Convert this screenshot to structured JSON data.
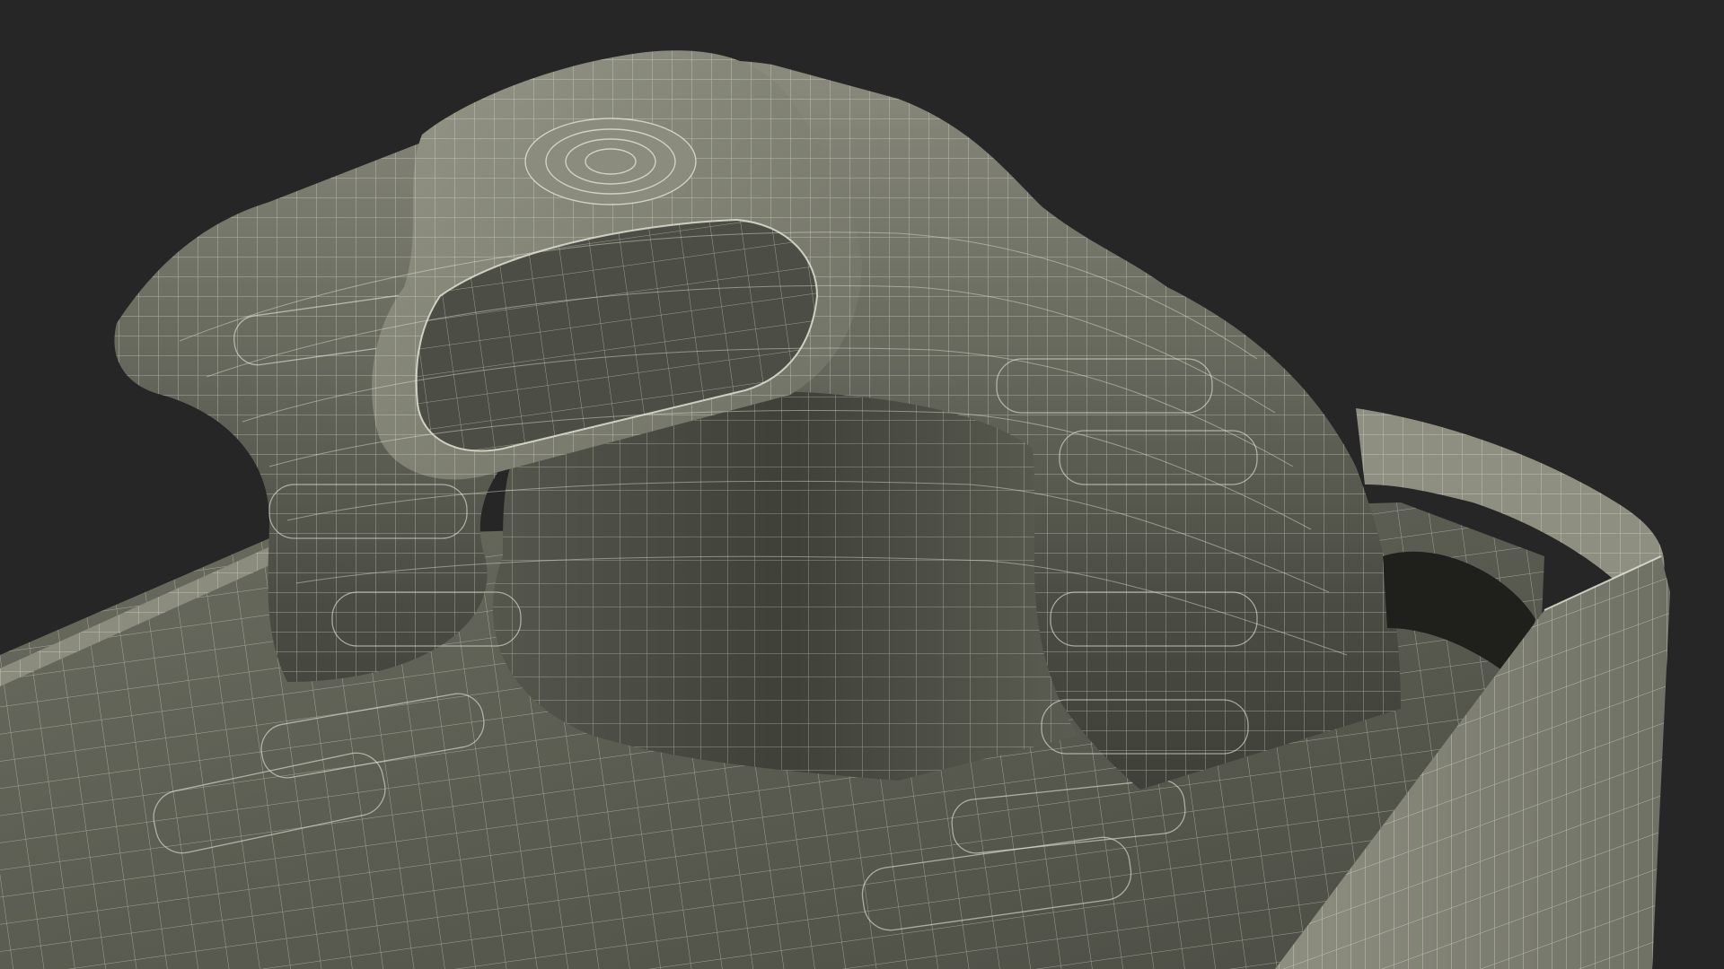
{
  "scene": {
    "subject": "wireframe-tin-can-with-rolled-lid-and-pull-ring",
    "colors": {
      "background": "#262626",
      "surface_light": "#8d8e80",
      "surface_mid": "#66685c",
      "surface_dark": "#44463e",
      "shadow": "#1f1f1c",
      "wire": "#e8e8dc"
    },
    "wireframe": true
  }
}
